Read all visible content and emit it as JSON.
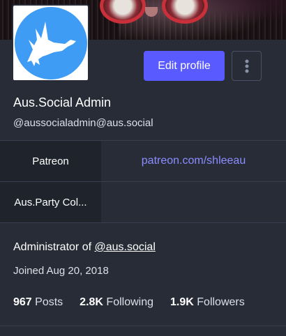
{
  "profile": {
    "display_name": "Aus.Social Admin",
    "handle": "@aussocialadmin@aus.social",
    "edit_button": "Edit profile",
    "more_icon": "vertical-ellipsis-icon",
    "avatar_icon": "goose-logo-icon",
    "avatar_color": "#3f9cf5"
  },
  "fields": [
    {
      "name": "Patreon",
      "value": "patreon.com/shleeau"
    },
    {
      "name": "Aus.Party Col...",
      "value": ""
    }
  ],
  "bio": {
    "prefix": "Administrator of ",
    "link": "@aus.social"
  },
  "joined": "Joined Aug 20, 2018",
  "stats": {
    "posts_count": "967",
    "posts_label": "Posts",
    "following_count": "2.8K",
    "following_label": "Following",
    "followers_count": "1.9K",
    "followers_label": "Followers"
  },
  "colors": {
    "accent": "#595aff",
    "link": "#8c8dff",
    "background": "#282c37"
  }
}
